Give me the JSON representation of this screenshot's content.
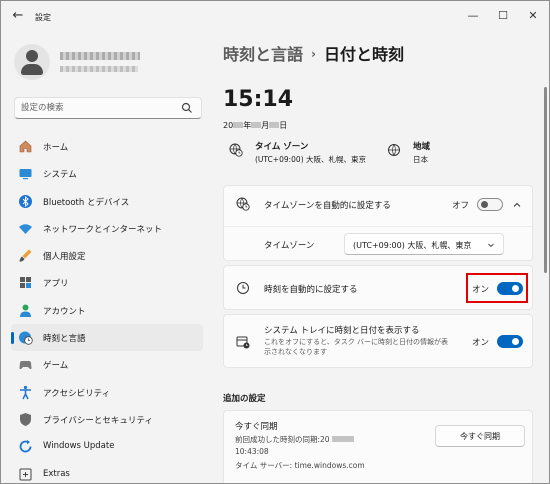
{
  "app": {
    "title": "設定"
  },
  "window_controls": {
    "minimize": "—",
    "maximize": "☐",
    "close": "✕"
  },
  "search": {
    "placeholder": "設定の検索"
  },
  "sidebar": {
    "items": [
      {
        "label": "ホーム",
        "icon": "home-icon"
      },
      {
        "label": "システム",
        "icon": "monitor-icon"
      },
      {
        "label": "Bluetooth とデバイス",
        "icon": "bluetooth-icon"
      },
      {
        "label": "ネットワークとインターネット",
        "icon": "wifi-icon"
      },
      {
        "label": "個人用設定",
        "icon": "brush-icon"
      },
      {
        "label": "アプリ",
        "icon": "apps-icon"
      },
      {
        "label": "アカウント",
        "icon": "account-icon"
      },
      {
        "label": "時刻と言語",
        "icon": "globe-clock-icon",
        "selected": true
      },
      {
        "label": "ゲーム",
        "icon": "gamepad-icon"
      },
      {
        "label": "アクセシビリティ",
        "icon": "accessibility-icon"
      },
      {
        "label": "プライバシーとセキュリティ",
        "icon": "shield-icon"
      },
      {
        "label": "Windows Update",
        "icon": "update-icon"
      },
      {
        "label": "Extras",
        "icon": "extras-icon"
      }
    ]
  },
  "breadcrumb": {
    "parent": "時刻と言語",
    "sep": "›",
    "current": "日付と時刻"
  },
  "clock": {
    "time": "15:14",
    "date_prefix": "20",
    "date_year": "年",
    "date_month": "月",
    "date_day": "日"
  },
  "timezone_info": {
    "label": "タイム ゾーン",
    "value": "(UTC+09:00) 大阪、札幌、東京"
  },
  "region_info": {
    "label": "地域",
    "value": "日本"
  },
  "auto_timezone": {
    "label": "タイムゾーンを自動的に設定する",
    "state_label": "オフ",
    "on": false
  },
  "timezone_row": {
    "label": "タイムゾーン",
    "value": "(UTC+09:00) 大阪、札幌、東京"
  },
  "auto_time": {
    "label": "時刻を自動的に設定する",
    "state_label": "オン",
    "on": true
  },
  "tray": {
    "label": "システム トレイに時刻と日付を表示する",
    "description": "これをオフにすると、タスク バーに時刻と日付の情報が表示されなくなります",
    "state_label": "オン",
    "on": true
  },
  "additional": {
    "heading": "追加の設定",
    "sync_title": "今すぐ同期",
    "last_sync_label": "前回成功した時刻の同期:20",
    "last_sync_time": "10:43:08",
    "server": "タイム サーバー: time.windows.com",
    "sync_button": "今すぐ同期"
  },
  "colors": {
    "accent": "#0067c0",
    "highlight": "#e00000",
    "background": "#f3f3f3"
  }
}
